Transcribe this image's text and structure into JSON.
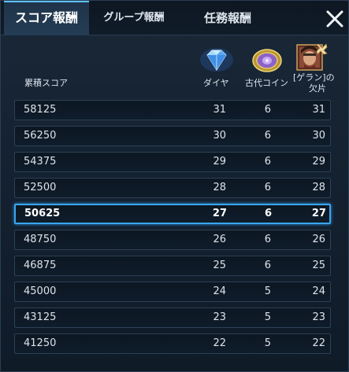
{
  "tabs": [
    {
      "label": "スコア報酬",
      "active": true
    },
    {
      "label": "グループ報酬",
      "active": false
    },
    {
      "label": "任務報酬",
      "active": false
    }
  ],
  "header": {
    "score_label": "累積スコア",
    "diamond_label": "ダイヤ",
    "coin_label": "古代コイン",
    "fragment_label_line1": "[ゲラン]の",
    "fragment_label_line2": "欠片"
  },
  "rows": [
    {
      "score": "58125",
      "diamond": "31",
      "coin": "6",
      "fragment": "31"
    },
    {
      "score": "56250",
      "diamond": "30",
      "coin": "6",
      "fragment": "30"
    },
    {
      "score": "54375",
      "diamond": "29",
      "coin": "6",
      "fragment": "29"
    },
    {
      "score": "52500",
      "diamond": "28",
      "coin": "6",
      "fragment": "28"
    },
    {
      "score": "50625",
      "diamond": "27",
      "coin": "6",
      "fragment": "27",
      "selected": true
    },
    {
      "score": "48750",
      "diamond": "26",
      "coin": "6",
      "fragment": "26"
    },
    {
      "score": "46875",
      "diamond": "25",
      "coin": "6",
      "fragment": "25"
    },
    {
      "score": "45000",
      "diamond": "24",
      "coin": "5",
      "fragment": "24"
    },
    {
      "score": "43125",
      "diamond": "23",
      "coin": "5",
      "fragment": "23"
    },
    {
      "score": "41250",
      "diamond": "22",
      "coin": "5",
      "fragment": "22"
    }
  ],
  "icons": {
    "close": "close-icon",
    "diamond": "diamond-icon",
    "coin": "ancient-coin-icon",
    "fragment": "hero-fragment-icon"
  },
  "colors": {
    "accent": "#39a7f0",
    "panel": "#152231"
  }
}
